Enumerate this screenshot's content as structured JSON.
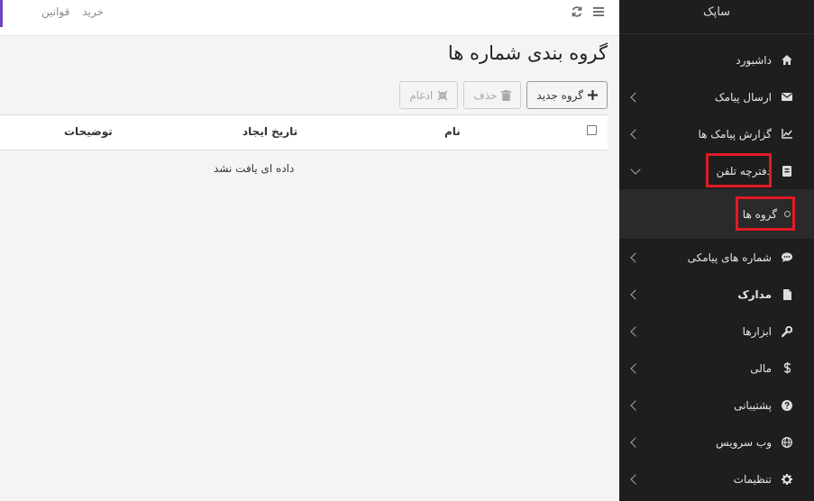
{
  "app": {
    "brand": "ساپک"
  },
  "topbar": {
    "links": [
      "خرید",
      "قوانین"
    ]
  },
  "sidebar": {
    "items": [
      {
        "label": "داشبورد",
        "icon": "home-icon",
        "chevron": false
      },
      {
        "label": "ارسال پیامک",
        "icon": "envelope-icon",
        "chevron": true
      },
      {
        "label": "گزارش پیامک ها",
        "icon": "chart-icon",
        "chevron": true
      },
      {
        "label": "دفترچه تلفن",
        "icon": "address-book-icon",
        "chevron": true,
        "expanded": true
      },
      {
        "label": "شماره های پیامکی",
        "icon": "comment-icon",
        "chevron": true
      },
      {
        "label": "مدارک",
        "icon": "file-icon",
        "chevron": true
      },
      {
        "label": "ابزارها",
        "icon": "wrench-icon",
        "chevron": true
      },
      {
        "label": "مالی",
        "icon": "dollar-icon",
        "chevron": true
      },
      {
        "label": "پشتیبانی",
        "icon": "question-icon",
        "chevron": true
      },
      {
        "label": "وب سرویس",
        "icon": "globe-icon",
        "chevron": true
      },
      {
        "label": "تنظیمات",
        "icon": "gear-icon",
        "chevron": true
      }
    ],
    "subitem": {
      "label": "گروه ها"
    },
    "highlight_color": "#e01b24"
  },
  "page": {
    "title": "گروه بندی شماره ها",
    "buttons": {
      "new": "گروه جدید",
      "delete": "حذف",
      "merge": "ادغام"
    },
    "table": {
      "columns": {
        "name": "نام",
        "created": "تاریخ ایجاد",
        "description": "توضیحات"
      },
      "empty": "داده ای یافت نشد"
    }
  }
}
